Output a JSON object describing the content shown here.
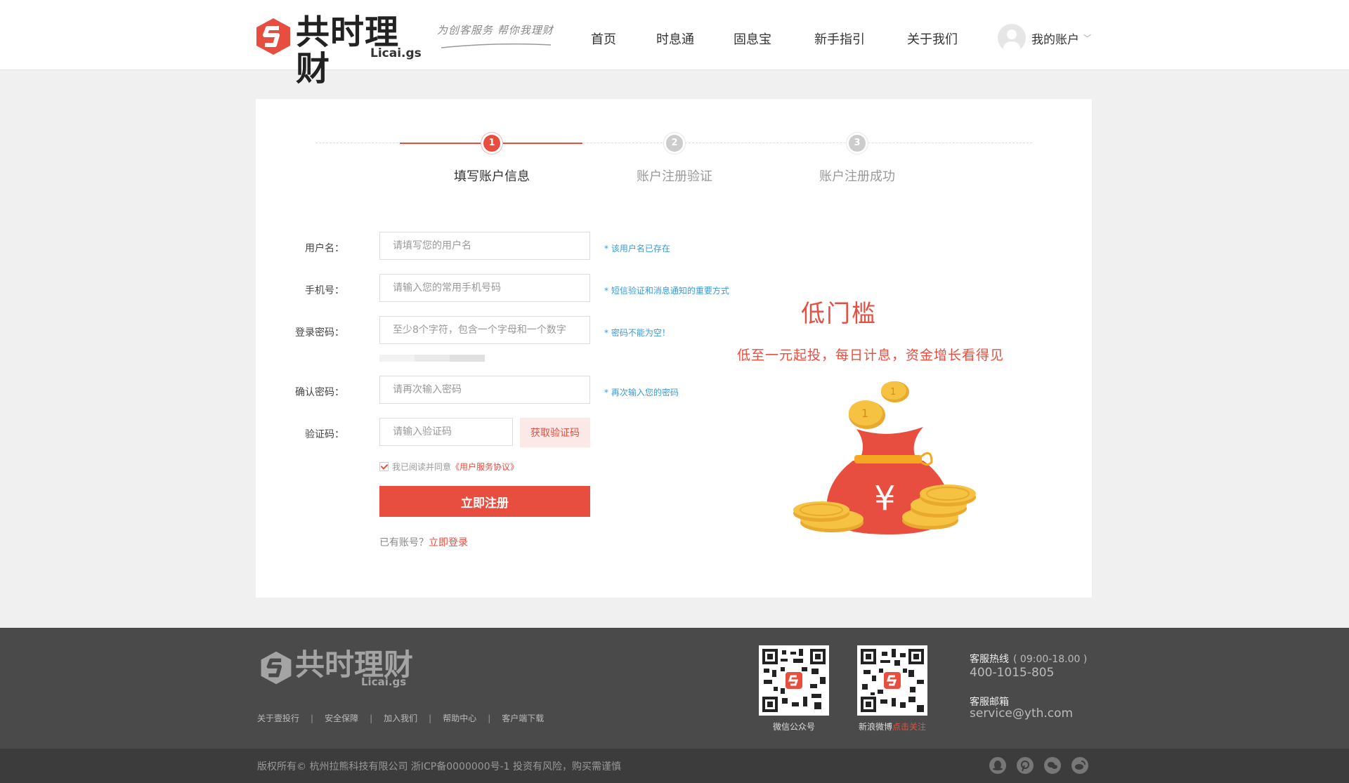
{
  "header": {
    "logo_text": "共时理财",
    "logo_sub": "Licai.gs",
    "slogan": "为创客服务  帮你我理财",
    "nav": [
      "首页",
      "时息通",
      "固息宝",
      "新手指引",
      "关于我们"
    ],
    "account_label": "我的账户"
  },
  "steps": [
    {
      "num": "1",
      "label": "填写账户信息",
      "state": "active"
    },
    {
      "num": "2",
      "label": "账户注册验证",
      "state": "inactive"
    },
    {
      "num": "3",
      "label": "账户注册成功",
      "state": "inactive"
    }
  ],
  "form": {
    "username": {
      "label": "用户名：",
      "placeholder": "请填写您的用户名",
      "hint": "* 该用户名已存在"
    },
    "phone": {
      "label": "手机号：",
      "placeholder": "请输入您的常用手机号码",
      "hint": "* 短信验证和消息通知的重要方式"
    },
    "password": {
      "label": "登录密码：",
      "placeholder": "至少8个字符，包含一个字母和一个数字",
      "hint": "* 密码不能为空！"
    },
    "confirm": {
      "label": "确认密码：",
      "placeholder": "请再次输入密码",
      "hint": "* 再次输入您的密码"
    },
    "captcha": {
      "label": "验证码：",
      "placeholder": "请输入验证码",
      "button": "获取验证码"
    },
    "agree_text": "我已阅读并同意",
    "agree_link": "《用户服务协议》",
    "submit": "立即注册",
    "has_account": "已有账号？",
    "login_link": "立即登录"
  },
  "promo": {
    "title": "低门槛",
    "subtitle": "低至一元起投，每日计息，资金增长看得见",
    "bag_symbol": "¥",
    "coin_mark": "1"
  },
  "footer": {
    "logo_text": "共时理财",
    "logo_sub": "Licai.gs",
    "links": [
      "关于壹投行",
      "安全保障",
      "加入我们",
      "帮助中心",
      "客户端下载"
    ],
    "qr1_label": "微信公众号",
    "qr2_label": "新浪微博",
    "qr2_highlight": "点击关注",
    "hotline_title": "客服热线",
    "hotline_hours": "( 09:00-18.00 )",
    "hotline_number": "400-1015-805",
    "email_title": "客服邮箱",
    "email": "service@yth.com",
    "copyright": "版权所有© 杭州拉熊科技有限公司  浙ICP备0000000号-1  投资有风险，购买需谨慎"
  },
  "colors": {
    "accent": "#e84e40",
    "hint": "#3a9ad9",
    "footer_bg": "#4a4a4a",
    "bottom_bg": "#3c3c3c",
    "coin": "#f5c242"
  },
  "icons": [
    "logo-mark-icon",
    "avatar-icon",
    "chevron-down-icon",
    "qq-icon",
    "pinterest-icon",
    "wechat-icon",
    "weibo-icon"
  ]
}
